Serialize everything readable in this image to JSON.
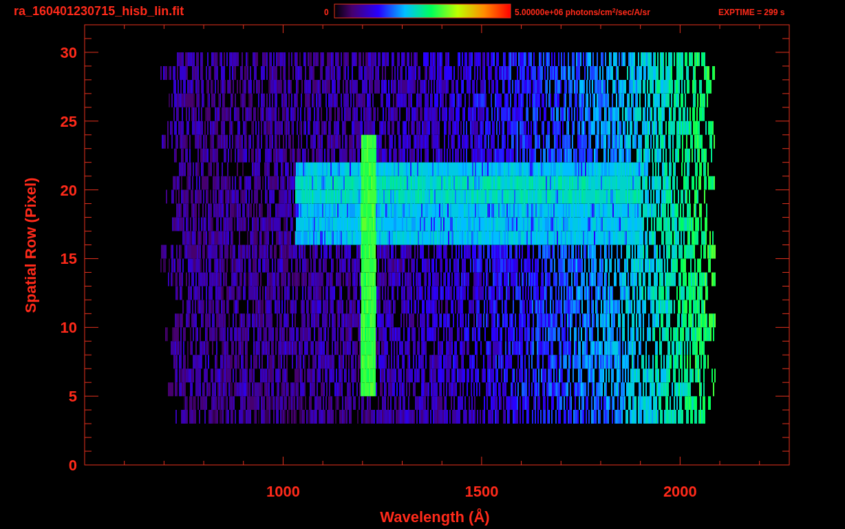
{
  "title": "ra_160401230715_hisb_lin.fit",
  "colorbar": {
    "min_label": "0",
    "max_label": "5.00000e+06 photons/cm$^{2}$/sec/A/sr"
  },
  "exposure": "EXPTIME = 299 s",
  "x_axis": {
    "label": "Wavelength (Å)",
    "ticks": [
      "1000",
      "1500",
      "2000"
    ]
  },
  "y_axis": {
    "label": "Spatial Row (Pixel)",
    "ticks": [
      "30",
      "25",
      "20",
      "15",
      "10",
      "5",
      "0"
    ]
  }
}
